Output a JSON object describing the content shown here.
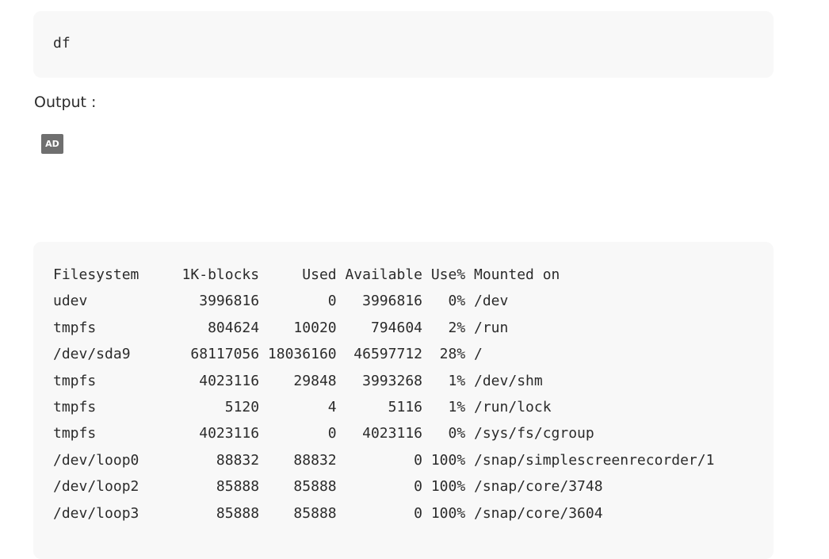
{
  "command_block": {
    "command": "df"
  },
  "output_label": "Output :",
  "ad_badge": "AD",
  "output_block": {
    "lines": [
      "Filesystem     1K-blocks     Used Available Use% Mounted on",
      "udev             3996816        0   3996816   0% /dev",
      "tmpfs             804624    10020    794604   2% /run",
      "/dev/sda9       68117056 18036160  46597712  28% /",
      "tmpfs            4023116    29848   3993268   1% /dev/shm",
      "tmpfs               5120        4      5116   1% /run/lock",
      "tmpfs            4023116        0   4023116   0% /sys/fs/cgroup",
      "/dev/loop0         88832    88832         0 100% /snap/simplescreenrecorder/1",
      "/dev/loop2         85888    85888         0 100% /snap/core/3748",
      "/dev/loop3         85888    85888         0 100% /snap/core/3604"
    ]
  }
}
